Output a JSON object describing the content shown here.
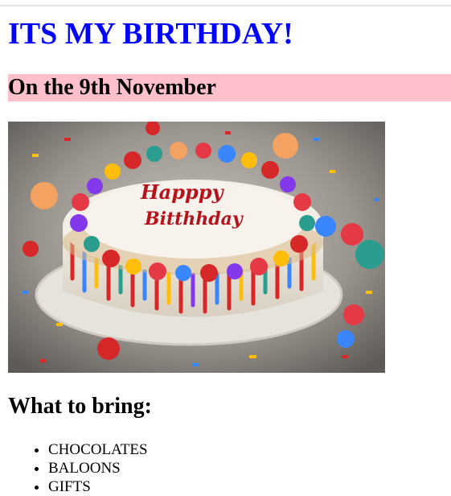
{
  "heading": {
    "title": "ITS MY BIRTHDAY!",
    "date": "On the 9th November"
  },
  "image": {
    "cake_text_line1": "Happpy",
    "cake_text_line2": "Bitthhday",
    "background_color": "#8f8b86",
    "cake_frosting_color": "#f3eee6"
  },
  "bring": {
    "heading": "What to bring:",
    "items": [
      "CHOCOLATES",
      "BALOONS",
      "GIFTS"
    ]
  },
  "colors": {
    "title": "#0000ff",
    "date_banner_bg": "#ffc0cb"
  }
}
